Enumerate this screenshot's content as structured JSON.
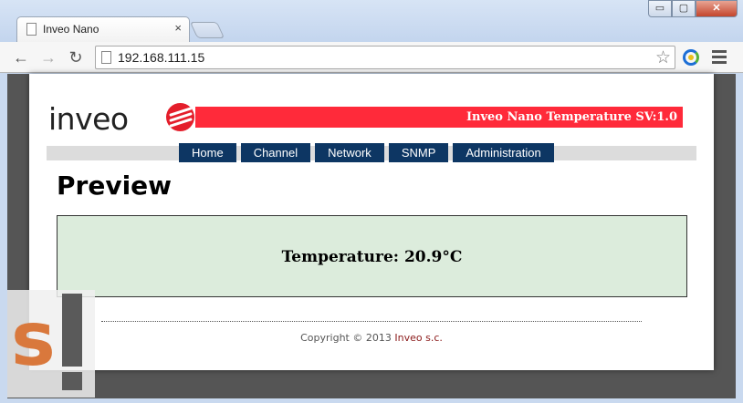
{
  "browser": {
    "tab_title": "Inveo Nano",
    "tab_close": "×",
    "url": "192.168.111.15",
    "window_buttons": {
      "minimize": "▭",
      "maximize": "▢",
      "close": "✕"
    },
    "nav": {
      "back": "←",
      "forward": "→",
      "reload": "↻"
    },
    "star": "☆",
    "icons": [
      "page-icon",
      "star-icon",
      "extension-icon",
      "menu-icon"
    ]
  },
  "header": {
    "logo_text": "inveo",
    "banner_text": "Inveo Nano Temperature SV:1.0"
  },
  "nav": {
    "items": [
      {
        "label": "Home"
      },
      {
        "label": "Channel"
      },
      {
        "label": "Network"
      },
      {
        "label": "SNMP"
      },
      {
        "label": "Administration"
      }
    ]
  },
  "main": {
    "title": "Preview",
    "temperature_label": "Temperature:",
    "temperature_value": "20.9°C"
  },
  "footer": {
    "copyright": "Copyright © 2013",
    "company": "Inveo s.c."
  },
  "colors": {
    "banner": "#ff2a3a",
    "nav_bg": "#0d3663",
    "panel_bg": "#dcecdc"
  }
}
